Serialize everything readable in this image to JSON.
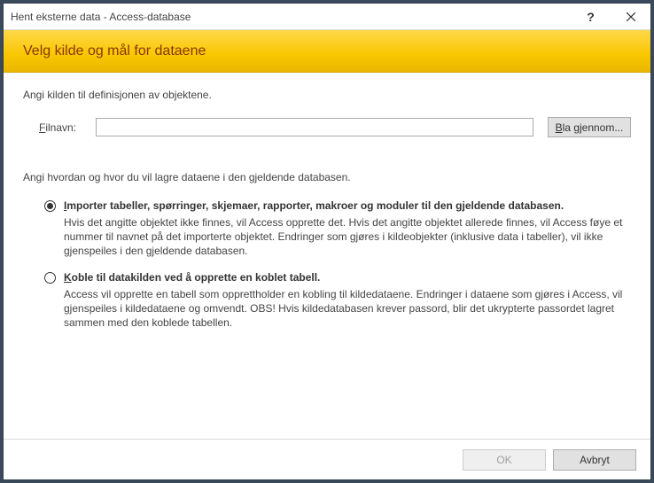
{
  "titlebar": {
    "title": "Hent eksterne data - Access-database",
    "help_label": "?",
    "close_label": "✕"
  },
  "banner": {
    "title": "Velg kilde og mål for dataene"
  },
  "content": {
    "instruction1": "Angi kilden til definisjonen av objektene.",
    "file_label_pre": "F",
    "file_label_rest": "ilnavn:",
    "file_value": "",
    "browse_pre": "B",
    "browse_rest": "la gjennom...",
    "instruction2": "Angi hvordan og hvor du vil lagre dataene i den gjeldende databasen.",
    "option1": {
      "title_pre": "I",
      "title_rest": "mporter tabeller, spørringer, skjemaer, rapporter, makroer og moduler til den gjeldende databasen.",
      "desc": "Hvis det angitte objektet ikke finnes, vil Access opprette det. Hvis det angitte objektet allerede finnes, vil Access føye et nummer til navnet på det importerte objektet. Endringer som gjøres i kildeobjekter (inklusive data i tabeller), vil ikke gjenspeiles i den gjeldende databasen."
    },
    "option2": {
      "title_pre": "K",
      "title_rest": "oble til datakilden ved å opprette en koblet tabell.",
      "desc": "Access vil opprette en tabell som opprettholder en kobling til kildedataene. Endringer i dataene som gjøres i Access, vil gjenspeiles i kildedataene og omvendt. OBS!  Hvis kildedatabasen krever passord, blir det ukrypterte passordet lagret sammen med den koblede tabellen."
    }
  },
  "footer": {
    "ok_label": "OK",
    "cancel_label": "Avbryt"
  }
}
